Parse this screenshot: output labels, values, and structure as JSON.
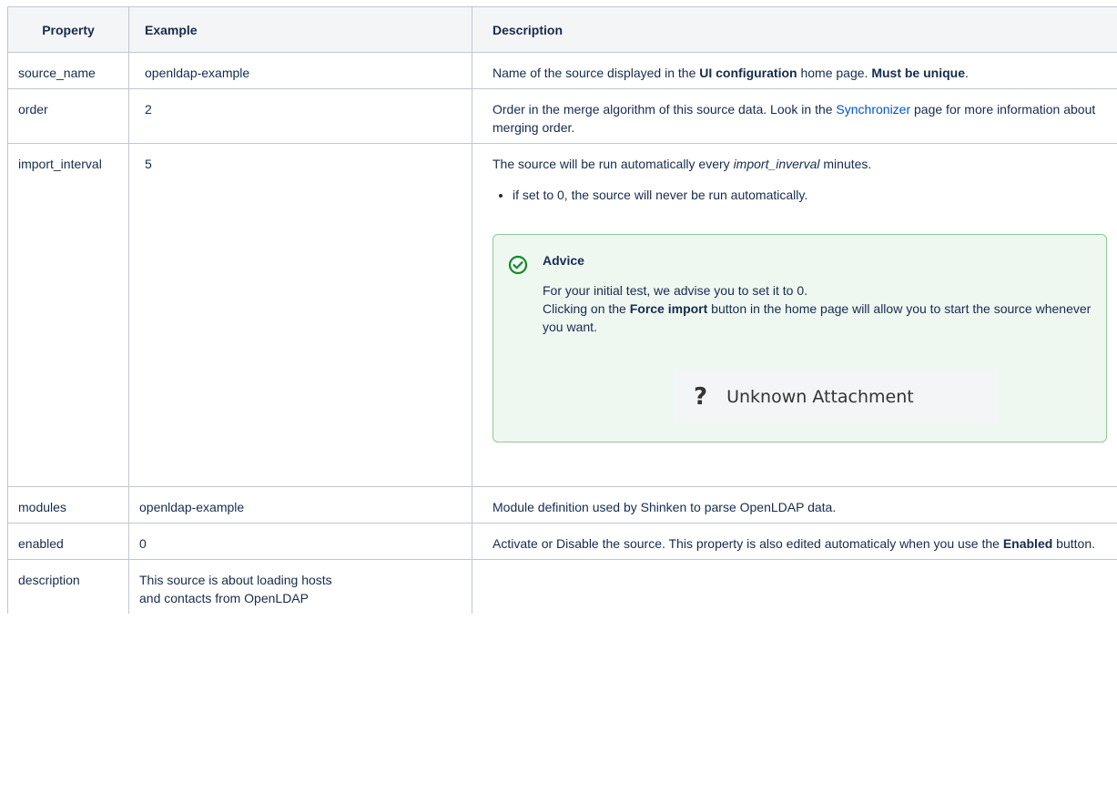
{
  "headers": {
    "property": "Property",
    "example": "Example",
    "description": "Description"
  },
  "rows": [
    {
      "property": "source_name",
      "example": "openldap-example"
    },
    {
      "property": "order",
      "example": "2"
    },
    {
      "property": "import_interval",
      "example": "5"
    },
    {
      "property": "modules",
      "example": "openldap-example"
    },
    {
      "property": "enabled",
      "example": "0"
    },
    {
      "property": "description",
      "example": "This source is about loading hosts and contacts from OpenLDAP"
    }
  ],
  "desc": {
    "source_name": {
      "t1": "Name of the source displayed in the ",
      "b1": "UI configuration",
      "t2": " home page. ",
      "b2": "Must be unique",
      "t3": "."
    },
    "order": {
      "t1": "Order in the merge algorithm of this source data. Look in the ",
      "link": "Synchronizer",
      "t2": " page for more information about merging order."
    },
    "import_interval": {
      "t1": "The source will be run automatically every ",
      "i1": "import_inverval",
      "t2": " minutes.",
      "bullet": "if set to 0, the source will never be run automatically.",
      "advice_title": "Advice",
      "advice_line1": "For your initial test, we advise you to set it to 0.",
      "advice_t1": "Clicking on the ",
      "advice_b1": "Force import",
      "advice_t2": " button in the home page will allow you to start the source whenever you want.",
      "attachment_symbol": "?",
      "attachment_label": "Unknown Attachment"
    },
    "modules": {
      "t1": "Module definition used by Shinken to parse OpenLDAP data."
    },
    "enabled": {
      "t1": "Activate or Disable the source. This property is also edited automaticaly when you use the ",
      "b1": "Enabled",
      "t2": " button."
    }
  },
  "colors": {
    "link": "#0052cc",
    "advice_border": "#8fca9c",
    "advice_bg": "#eff7f1",
    "advice_icon": "#14892c"
  },
  "icons": {
    "advice": "check-circle-icon"
  }
}
